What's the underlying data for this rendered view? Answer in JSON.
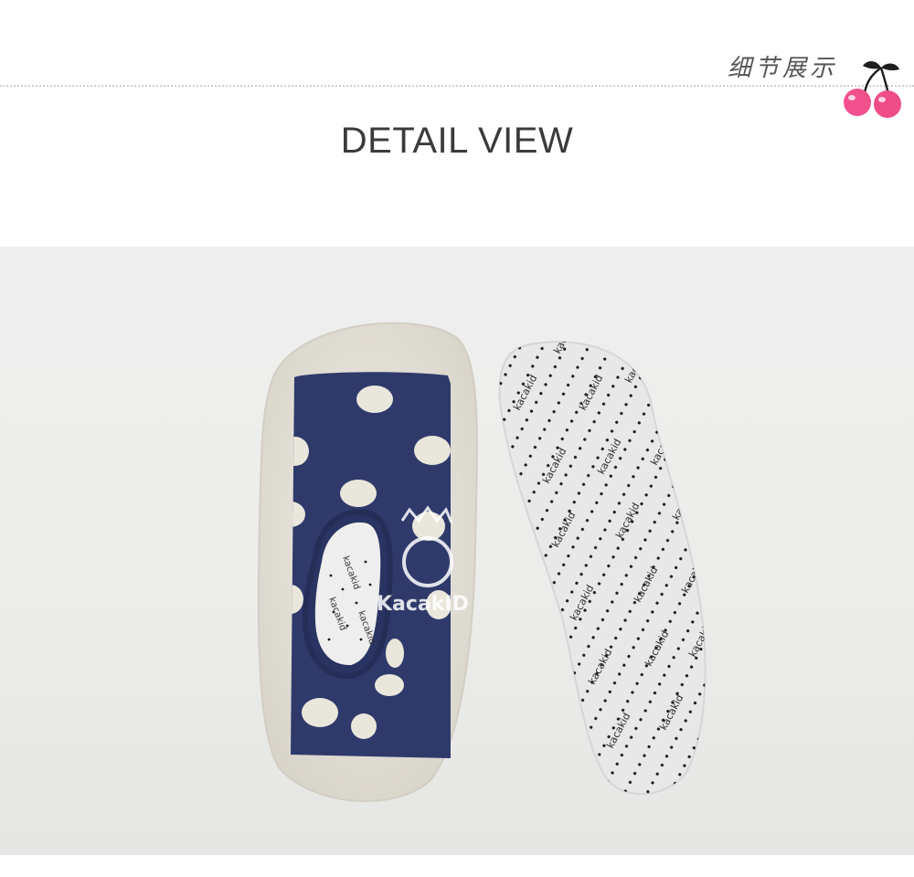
{
  "header": {
    "chinese_label": "细节展示",
    "title": "DETAIL VIEW"
  },
  "photo": {
    "watermark_brand": "KacakID",
    "insole_print": "kacakid",
    "sock_insole_print": "kacakid"
  },
  "colors": {
    "title_text": "#3b3b3b",
    "sock_navy": "#2f3a6b",
    "polka_dot": "#e9e6dc",
    "sole_rubber": "#e7e3da",
    "insole_base": "#e8e8e8",
    "cherry_pink": "#f0508c",
    "cherry_stem": "#1e1e1e"
  }
}
